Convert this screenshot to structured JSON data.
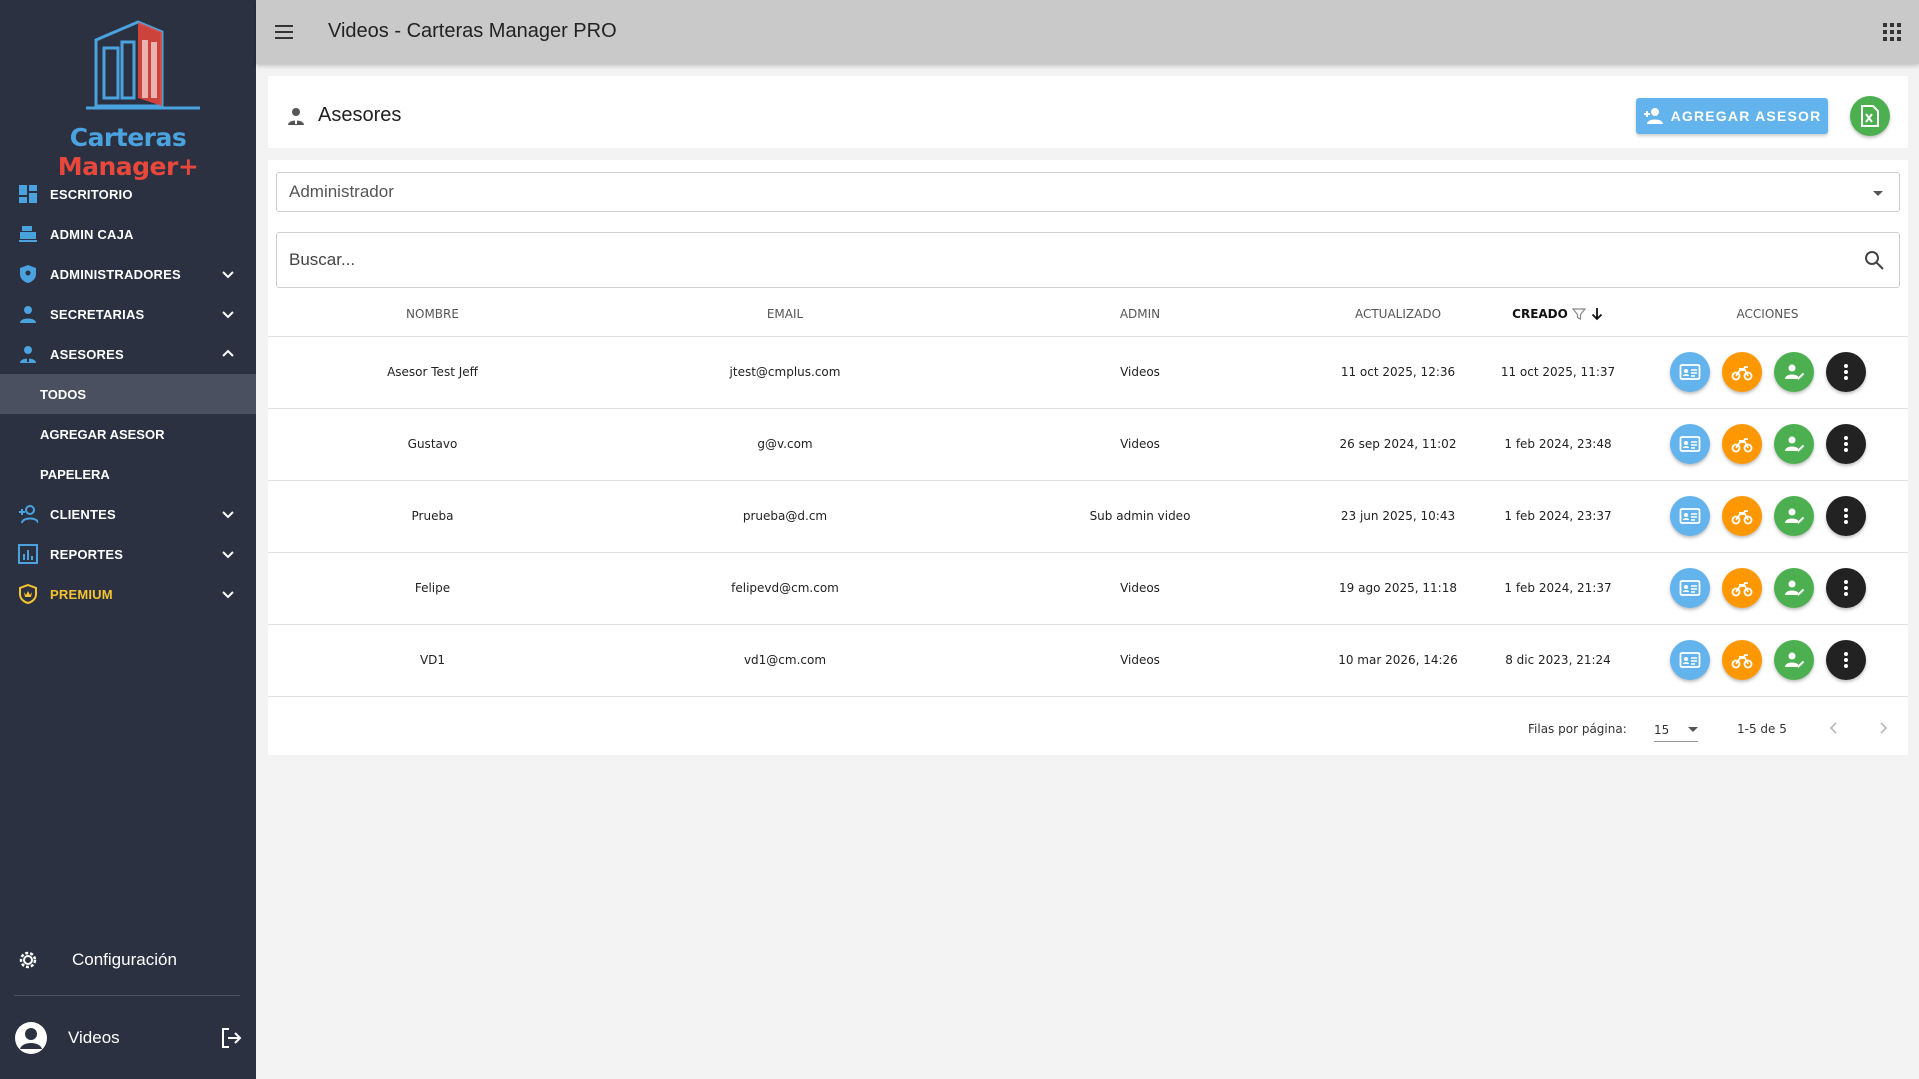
{
  "app": {
    "title": "Videos - Carteras Manager PRO",
    "logo_part1": "Carteras ",
    "logo_part2": "Manager+"
  },
  "sidebar": {
    "items": [
      {
        "label": "ESCRITORIO"
      },
      {
        "label": "ADMIN CAJA"
      },
      {
        "label": "ADMINISTRADORES"
      },
      {
        "label": "SECRETARIAS"
      },
      {
        "label": "ASESORES"
      },
      {
        "label": "CLIENTES"
      },
      {
        "label": "REPORTES"
      },
      {
        "label": "PREMIUM"
      }
    ],
    "asesores_sub": [
      {
        "label": "TODOS"
      },
      {
        "label": "AGREGAR ASESOR"
      },
      {
        "label": "PAPELERA"
      }
    ],
    "config_label": "Configuración",
    "user_name": "Videos",
    "premium_color": "#f4c430"
  },
  "page": {
    "title": "Asesores",
    "add_button": "AGREGAR ASESOR",
    "admin_select": "Administrador",
    "search_placeholder": "Buscar..."
  },
  "table": {
    "headers": {
      "nombre": "NOMBRE",
      "email": "EMAIL",
      "admin": "ADMIN",
      "actualizado": "ACTUALIZADO",
      "creado": "CREADO",
      "acciones": "ACCIONES"
    },
    "rows": [
      {
        "nombre": "Asesor Test Jeff",
        "email": "jtest@cmplus.com",
        "admin": "Videos",
        "actualizado": "11 oct 2025, 12:36",
        "creado": "11 oct 2025, 11:37"
      },
      {
        "nombre": "Gustavo",
        "email": "g@v.com",
        "admin": "Videos",
        "actualizado": "26 sep 2024, 11:02",
        "creado": "1 feb 2024, 23:48"
      },
      {
        "nombre": "Prueba",
        "email": "prueba@d.cm",
        "admin": "Sub admin video",
        "actualizado": "23 jun 2025, 10:43",
        "creado": "1 feb 2024, 23:37"
      },
      {
        "nombre": "Felipe",
        "email": "felipevd@cm.com",
        "admin": "Videos",
        "actualizado": "19 ago 2025, 11:18",
        "creado": "1 feb 2024, 21:37"
      },
      {
        "nombre": "VD1",
        "email": "vd1@cm.com",
        "admin": "Videos",
        "actualizado": "10 mar 2026, 14:26",
        "creado": "8 dic 2023, 21:24"
      }
    ]
  },
  "pagination": {
    "rows_label": "Filas por página:",
    "rows_per_page": "15",
    "range": "1-5 de 5"
  },
  "colors": {
    "sidebar_bg": "#2b3141",
    "accent_blue": "#63b3ec",
    "accent_orange": "#ff9800",
    "accent_green": "#4caf50",
    "accent_dark": "#222222"
  }
}
